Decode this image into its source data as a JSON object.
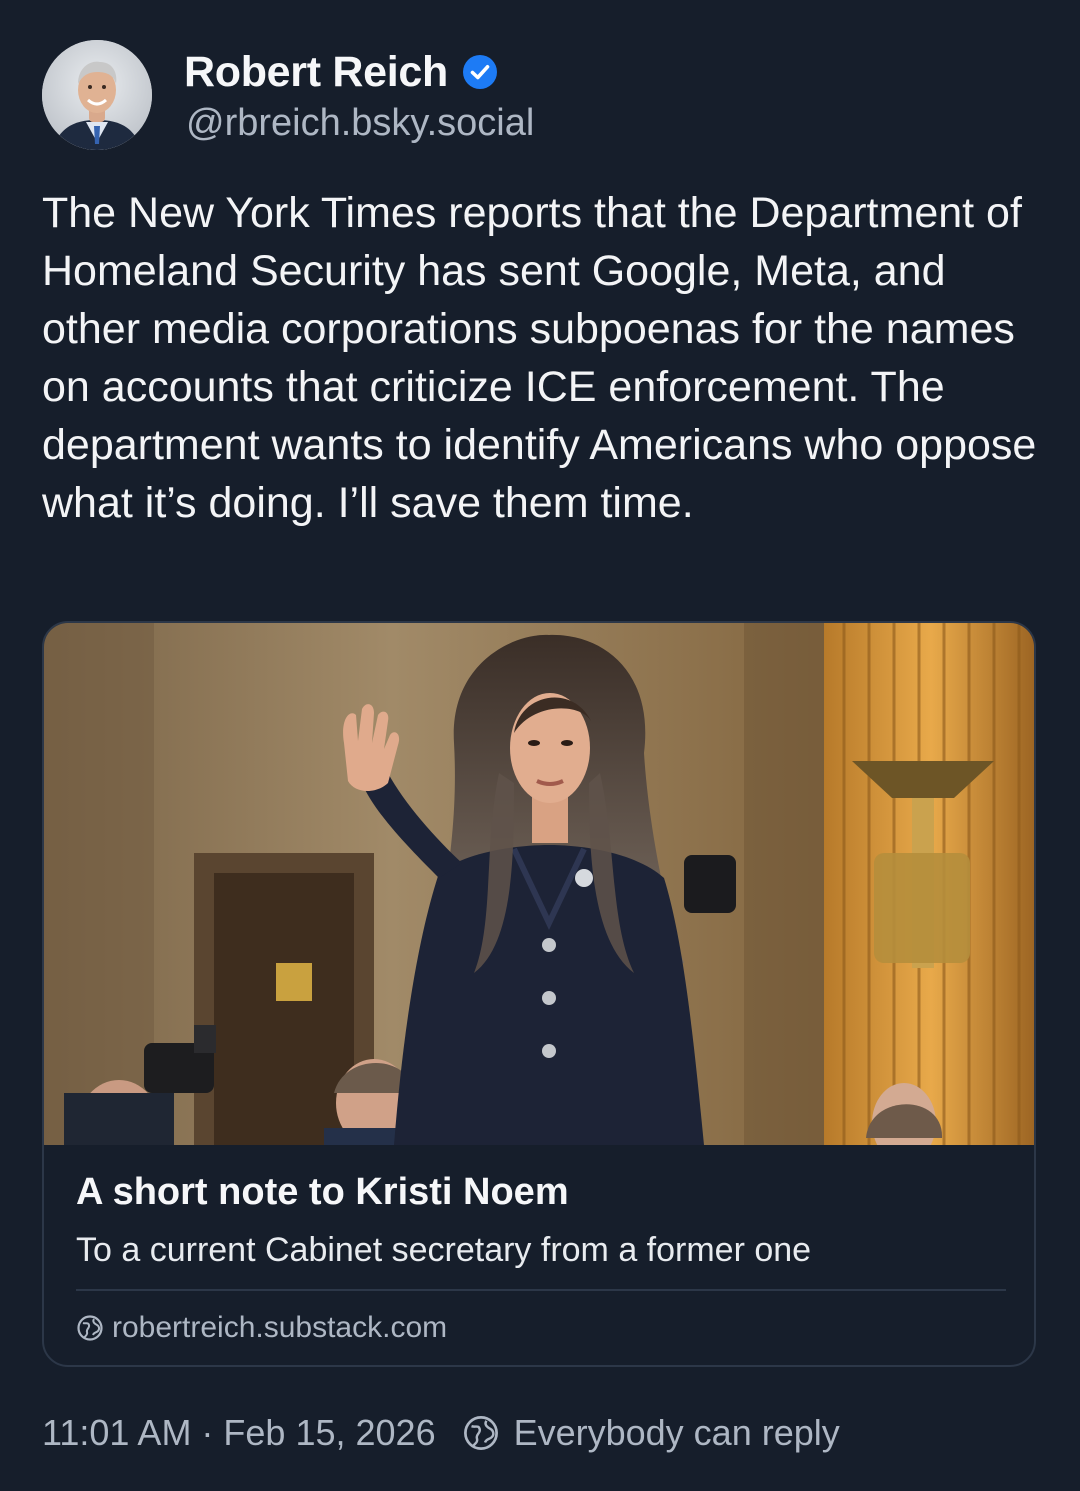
{
  "author": {
    "display_name": "Robert Reich",
    "handle": "@rbreich.bsky.social",
    "verified": true,
    "avatar_icon": "avatar-photo"
  },
  "post": {
    "text": "The New York Times reports that the Department of Homeland Security has sent Google, Meta, and other media corporations subpoenas for the names on accounts that criticize ICE enforcement. The department wants to identify Americans who oppose what it’s doing. I’ll save them time."
  },
  "link_card": {
    "image_icon": "article-photo",
    "title": "A short note to Kristi Noem",
    "description": "To a current Cabinet secretary from a former one",
    "domain": "robertreich.substack.com"
  },
  "footer": {
    "timestamp": "11:01 AM · Feb 15, 2026",
    "reply_setting": "Everybody can reply"
  },
  "colors": {
    "background": "#161e2b",
    "verified_badge": "#1d7bf5",
    "muted_text": "#aeb7c4",
    "border": "#2c3748"
  }
}
